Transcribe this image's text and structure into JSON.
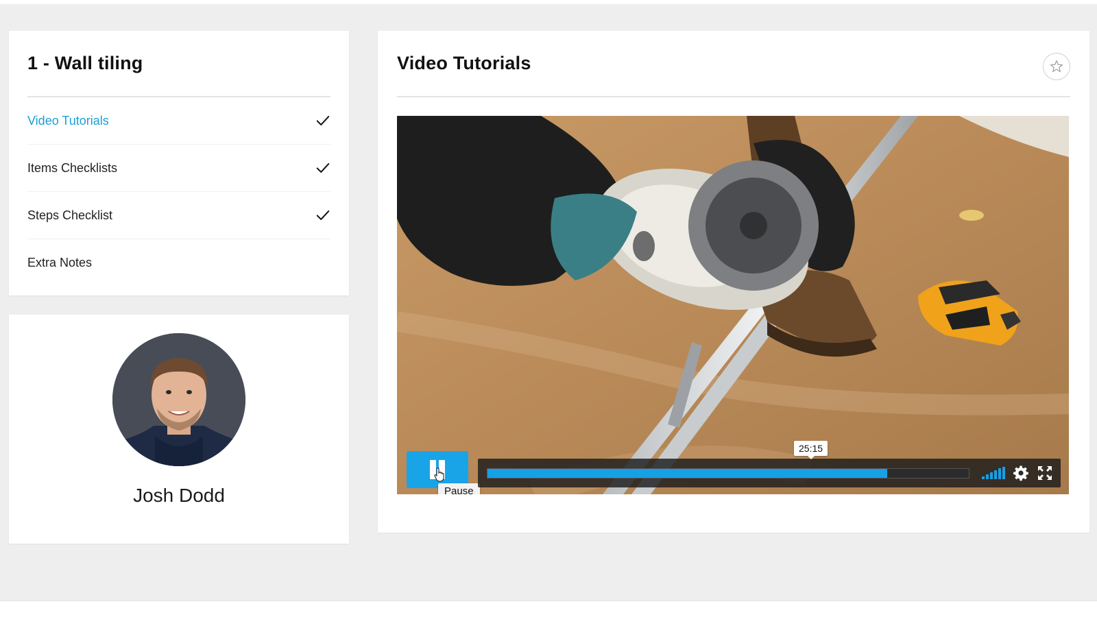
{
  "sidebar": {
    "title": "1 - Wall tiling",
    "items": [
      {
        "label": "Video Tutorials",
        "active": true,
        "completed": true
      },
      {
        "label": "Items Checklists",
        "active": false,
        "completed": true
      },
      {
        "label": "Steps Checklist",
        "active": false,
        "completed": true
      },
      {
        "label": "Extra Notes",
        "active": false,
        "completed": false
      }
    ]
  },
  "profile": {
    "name": "Josh Dodd"
  },
  "main": {
    "title": "Video Tutorials",
    "player": {
      "pause_tooltip": "Pause",
      "hover_time": "25:15",
      "progress_fraction": 0.83,
      "volume_level": 1.0
    }
  },
  "colors": {
    "accent": "#1a9fd4",
    "player_button": "#1aa4e8",
    "progress": "#16a0e6",
    "page_background": "#eeeeee"
  },
  "icons": [
    "check-icon",
    "star-icon",
    "pause-icon",
    "cursor-hand-icon",
    "volume-icon",
    "gear-icon",
    "fullscreen-icon"
  ]
}
